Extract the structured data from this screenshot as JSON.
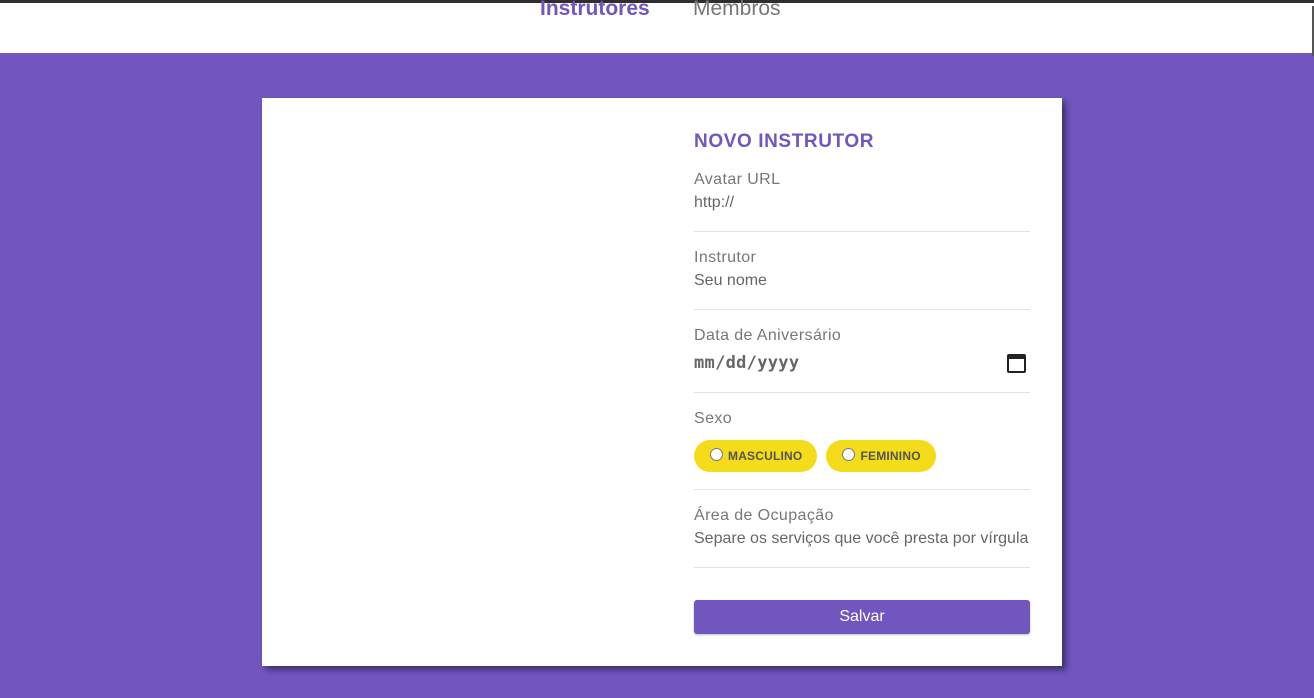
{
  "nav": {
    "items": [
      "Instrutores",
      "Membros"
    ],
    "active": "Instrutores"
  },
  "form": {
    "title": "NOVO INSTRUTOR",
    "avatar": {
      "label": "Avatar URL",
      "placeholder": "http://"
    },
    "name": {
      "label": "Instrutor",
      "placeholder": "Seu nome"
    },
    "birth": {
      "label": "Data de Aniversário",
      "placeholder": "mm/dd/yyyy",
      "icon": "calendar-icon"
    },
    "gender": {
      "label": "Sexo",
      "options": [
        "MASCULINO",
        "FEMININO"
      ]
    },
    "services": {
      "label": "Área de Ocupação",
      "placeholder": "Separe os serviços que você presta por vírgula"
    },
    "save_label": "Salvar"
  },
  "colors": {
    "primary": "#7156bf",
    "pill": "#f4dc1a",
    "background": "#7156bf",
    "card": "#ffffff"
  }
}
